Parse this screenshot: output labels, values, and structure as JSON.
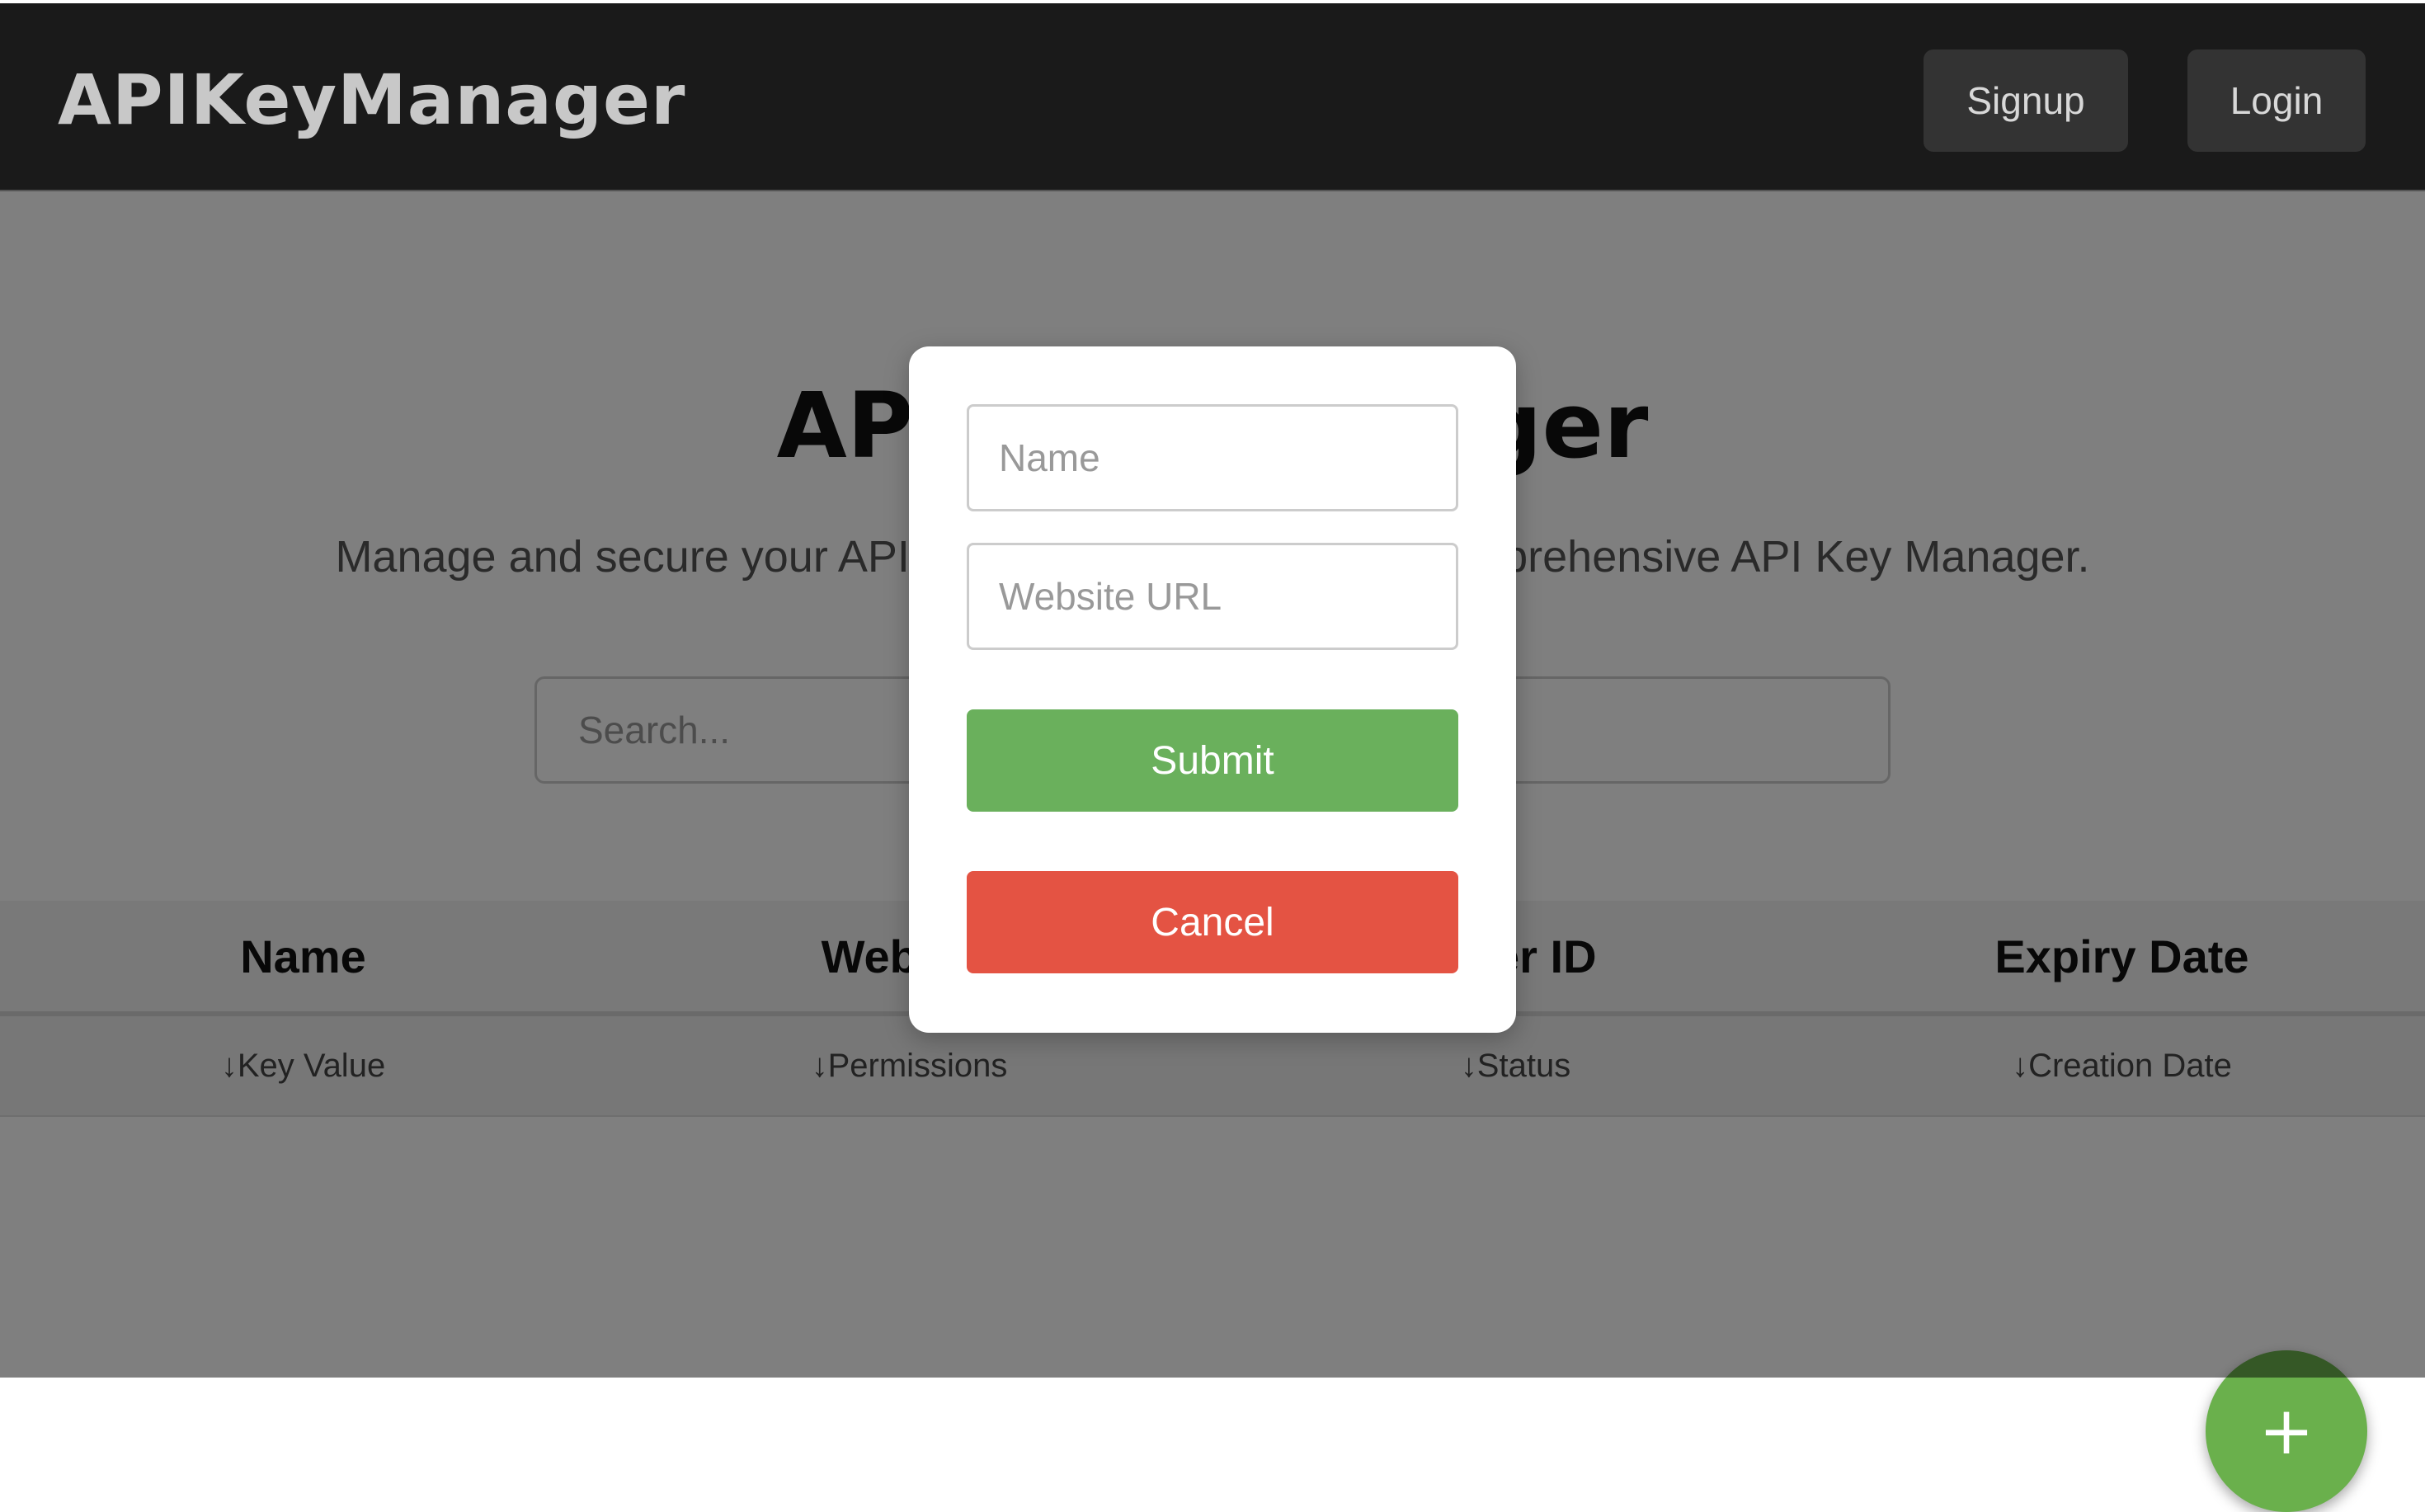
{
  "app": {
    "brand": "APIKeyManager"
  },
  "nav": {
    "signup_label": "Signup",
    "login_label": "Login"
  },
  "hero": {
    "title": "API Key Manager",
    "subtitle": "Manage and secure your API keys effortlessly with our comprehensive API Key Manager."
  },
  "search": {
    "placeholder": "Search..."
  },
  "table": {
    "headers": [
      "Name",
      "Website",
      "User ID",
      "Expiry Date"
    ],
    "sort_options": [
      "↓Key Value",
      "↓Permissions",
      "↓Status",
      "↓Creation Date"
    ]
  },
  "fab": {
    "label": "+"
  },
  "modal": {
    "name_placeholder": "Name",
    "url_placeholder": "Website URL",
    "submit_label": "Submit",
    "cancel_label": "Cancel"
  },
  "colors": {
    "header_bg": "#1a1a1a",
    "submit": "#6ab05c",
    "cancel": "#e45343",
    "fab": "#6ab04c",
    "overlay": "rgba(0,0,0,0.5)"
  },
  "icons": {
    "fab_icon": "plus-icon",
    "sort_icon": "arrow-down-icon"
  }
}
